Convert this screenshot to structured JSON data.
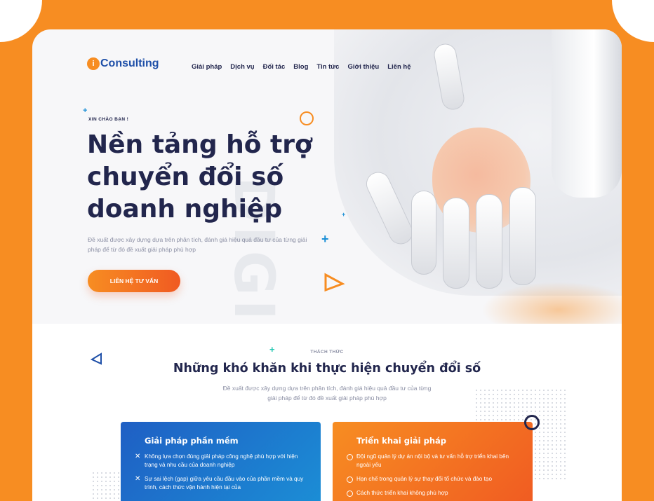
{
  "brand": {
    "logo_mark": "i",
    "logo_text": "Consulting"
  },
  "nav": {
    "items": [
      "Giải pháp",
      "Dịch vụ",
      "Đối tác",
      "Blog",
      "Tin tức",
      "Giới thiệu",
      "Liên hệ"
    ]
  },
  "hero": {
    "eyebrow": "XIN CHÀO BẠN !",
    "title_line1": "Nền tảng hỗ trợ",
    "title_line2": "chuyển đổi số",
    "title_line3": "doanh nghiệp",
    "description": "Đề xuất được xây dựng dựa trên phân tích, đánh giá hiệu quả đầu tư của từng giải pháp để từ đó đề xuất giải pháp phù hợp",
    "cta_label": "LIÊN HỆ TƯ VẤN",
    "watermark": "DIGITAL"
  },
  "challenge": {
    "tag": "THÁCH THỨC",
    "title": "Những khó khăn khi thực hiện chuyển đổi số",
    "description": "Đề xuất được xây dựng dựa trên phân tích, đánh giá hiệu quả đầu tư của từng giải pháp để từ đó đề xuất giải pháp phù hợp"
  },
  "cards": {
    "software": {
      "title": "Giải pháp phần mềm",
      "items": [
        "Không lựa chọn đúng giải pháp công nghệ phù hợp với hiện trạng và nhu cầu của doanh nghiệp",
        "Sự sai lệch (gap) giữa yêu cầu đầu vào của phần mềm và quy trình, cách thức vận hành hiện tại của"
      ]
    },
    "deployment": {
      "title": "Triển khai giải pháp",
      "items": [
        "Đội ngũ quản lý dự án nội bộ và tư vấn hỗ trợ triển khai bên ngoài yếu",
        "Hạn chế trong quản lý sự thay đổi tổ chức và đào tạo",
        "Cách thức triển khai không phù hợp"
      ]
    }
  },
  "colors": {
    "frame": "#f78d22",
    "heading": "#22264d",
    "brand_blue": "#1e4fa8",
    "accent_orange": "#f78d22",
    "accent_blue": "#1b8fd6",
    "accent_teal": "#1ec6b0"
  },
  "icons": {
    "cross": "✕",
    "plus": "+"
  }
}
